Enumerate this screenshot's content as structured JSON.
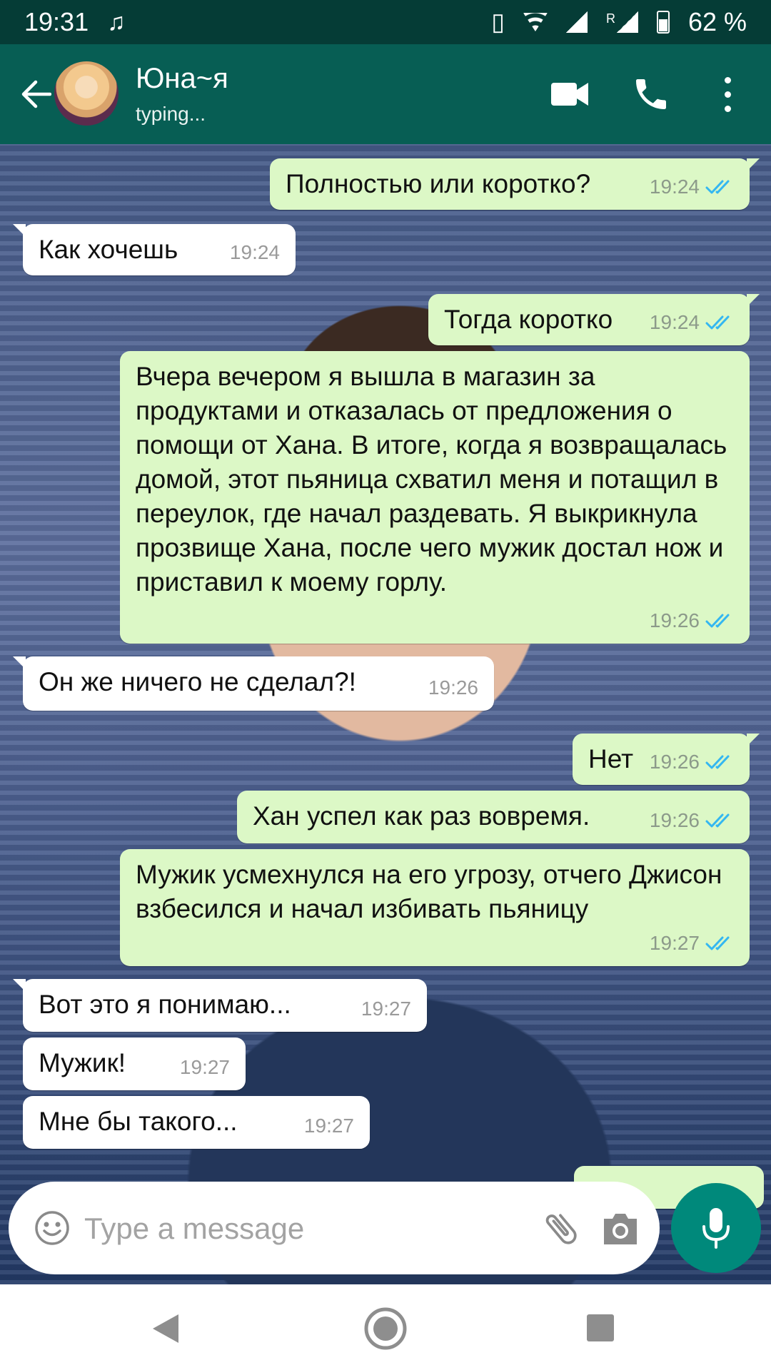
{
  "status_bar": {
    "time": "19:31",
    "roaming": "R",
    "battery": "62 %"
  },
  "header": {
    "contact_name": "Юна~я",
    "status": "typing..."
  },
  "messages": [
    {
      "direction": "out",
      "text": "Полностью или коротко?",
      "time": "19:24",
      "read": true
    },
    {
      "direction": "in",
      "text": "Как хочешь",
      "time": "19:24"
    },
    {
      "direction": "out",
      "text": "Тогда коротко",
      "time": "19:24",
      "read": true
    },
    {
      "direction": "out",
      "text": "Вчера вечером я вышла в магазин за продуктами и отказалась от предложения о помощи от Хана. В итоге, когда я возвращалась домой, этот пьяница схватил меня и потащил в переулок, где начал раздевать. Я выкрикнула прозвище Хана, после чего мужик достал нож и приставил к моему горлу.",
      "time": "19:26",
      "read": true
    },
    {
      "direction": "in",
      "text": "Он же ничего не сделал?!",
      "time": "19:26"
    },
    {
      "direction": "out",
      "text": "Нет",
      "time": "19:26",
      "read": true
    },
    {
      "direction": "out",
      "text": "Хан успел как раз вовремя.",
      "time": "19:26",
      "read": true
    },
    {
      "direction": "out",
      "text": "Мужик усмехнулся на его угрозу, отчего Джисон взбесился и начал избивать пьяницу",
      "time": "19:27",
      "read": true
    },
    {
      "direction": "in",
      "text": "Вот это я понимаю...",
      "time": "19:27"
    },
    {
      "direction": "in",
      "text": "Мужик!",
      "time": "19:27"
    },
    {
      "direction": "in",
      "text": "Мне бы такого...",
      "time": "19:27"
    }
  ],
  "composer": {
    "placeholder": "Type a message"
  },
  "colors": {
    "app_bar": "#075e54",
    "status_bar": "#053c36",
    "outgoing_bubble": "#dcf8c6",
    "incoming_bubble": "#ffffff",
    "read_ticks": "#34b7f1",
    "mic_button": "#00897b"
  },
  "icons": {
    "status_left": [
      "music-note-icon"
    ],
    "status_right": [
      "vibrate-icon",
      "wifi-icon",
      "signal-icon",
      "roaming-signal-icon",
      "battery-icon"
    ],
    "header": [
      "back-arrow-icon",
      "video-call-icon",
      "phone-icon",
      "more-vert-icon"
    ],
    "composer": [
      "emoji-icon",
      "attach-icon",
      "camera-icon",
      "mic-icon"
    ],
    "nav": [
      "nav-back-icon",
      "nav-home-icon",
      "nav-recents-icon"
    ]
  }
}
